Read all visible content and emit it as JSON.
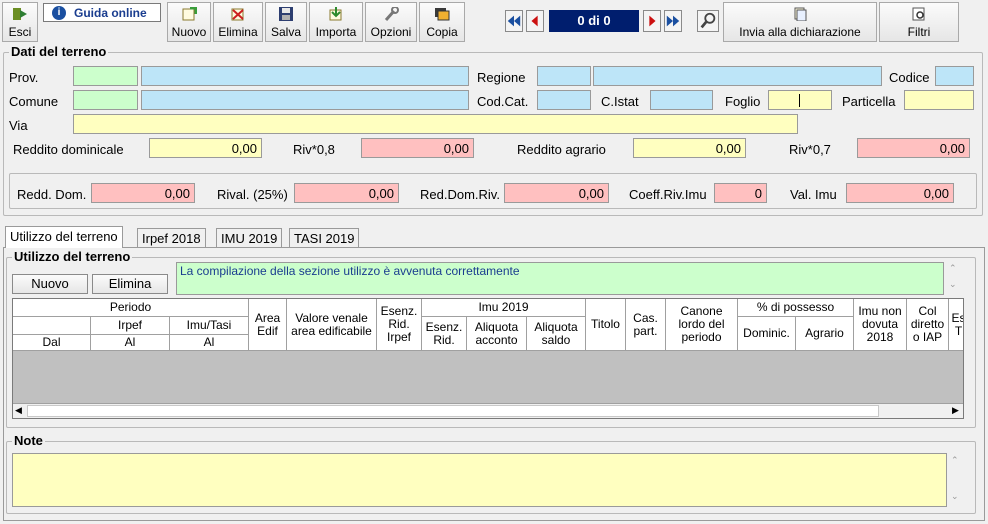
{
  "toolbar": {
    "exit": "Esci",
    "help": "Guida online",
    "new": "Nuovo",
    "delete": "Elimina",
    "save": "Salva",
    "import": "Importa",
    "options": "Opzioni",
    "copy": "Copia",
    "record_counter": "0 di 0",
    "send": "Invia alla dichiarazione",
    "filters": "Filtri"
  },
  "terreno": {
    "title": "Dati del terreno",
    "prov_label": "Prov.",
    "regione_label": "Regione",
    "codice_label": "Codice",
    "comune_label": "Comune",
    "codcat_label": "Cod.Cat.",
    "cistat_label": "C.Istat",
    "foglio_label": "Foglio",
    "particella_label": "Particella",
    "via_label": "Via",
    "reddito_dominicale_label": "Reddito dominicale",
    "reddito_dominicale_value": "0,00",
    "riv08_label": "Riv*0,8",
    "riv08_value": "0,00",
    "reddito_agrario_label": "Reddito agrario",
    "reddito_agrario_value": "0,00",
    "riv07_label": "Riv*0,7",
    "riv07_value": "0,00"
  },
  "summary": {
    "redd_dom_label": "Redd. Dom.",
    "redd_dom_value": "0,00",
    "rival_label": "Rival. (25%)",
    "rival_value": "0,00",
    "reddomriv_label": "Red.Dom.Riv.",
    "reddomriv_value": "0,00",
    "coeff_label": "Coeff.Riv.Imu",
    "coeff_value": "0",
    "valimu_label": "Val. Imu",
    "valimu_value": "0,00"
  },
  "tabs": [
    "Utilizzo del terreno",
    "Irpef 2018",
    "IMU 2019",
    "TASI 2019"
  ],
  "utilizzo": {
    "title": "Utilizzo del terreno",
    "new_button": "Nuovo",
    "delete_button": "Elimina",
    "message": "La compilazione della sezione utilizzo è avvenuta correttamente"
  },
  "grid": {
    "periodo": "Periodo",
    "irpef": "Irpef",
    "imu_tasi": "Imu/Tasi",
    "dal": "Dal",
    "al1": "Al",
    "al2": "Al",
    "area_edif": "Area Edif",
    "valore_venale": "Valore venale area edificabile",
    "esenz_rid_irpef": "Esenz. Rid. Irpef",
    "imu2019": "Imu 2019",
    "esenz_rid": "Esenz. Rid.",
    "aliquota_acconto": "Aliquota acconto",
    "aliquota_saldo": "Aliquota saldo",
    "titolo": "Titolo",
    "cas_part": "Cas. part.",
    "canone": "Canone lordo del periodo",
    "perc_possesso": "% di possesso",
    "dominic": "Dominic.",
    "agrario": "Agrario",
    "imu_non_dovuta": "Imu non dovuta 2018",
    "col_diretto": "Col diretto o IAP",
    "es_t": "Es T"
  },
  "note": {
    "title": "Note"
  },
  "colors": {
    "green": "#ccffcc",
    "blue": "#bde5f8",
    "yellow": "#ffffc0",
    "pink": "#ffc0c0",
    "counter_bg": "#001e6e"
  }
}
